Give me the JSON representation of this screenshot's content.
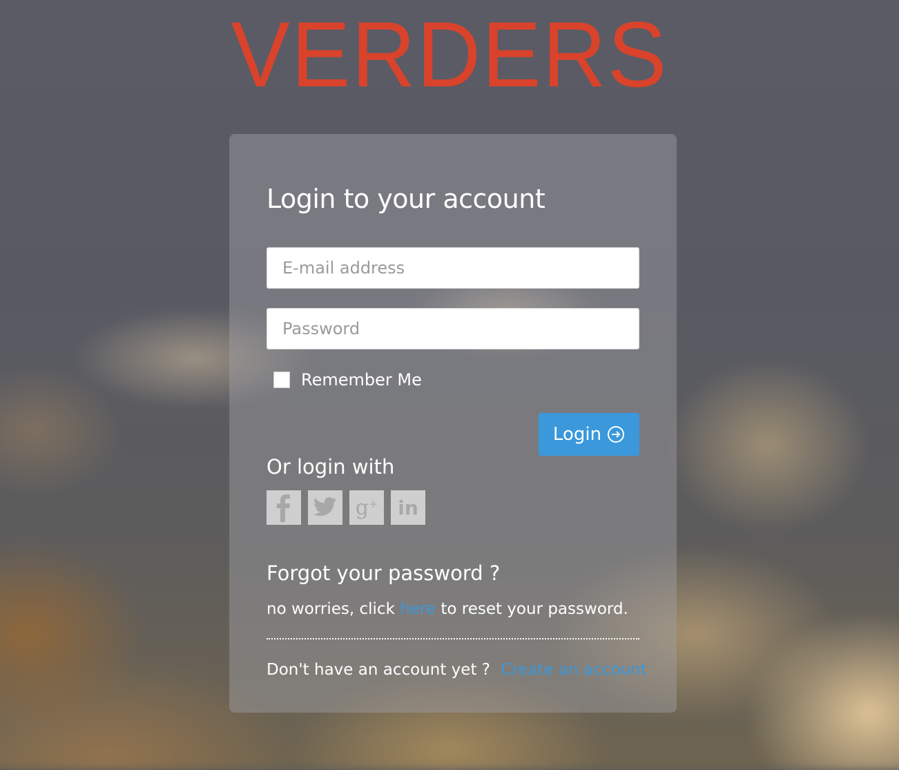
{
  "brand": {
    "logo_text": "VERDERS",
    "logo_color": "#d9432b"
  },
  "login_form": {
    "title": "Login to your account",
    "email_placeholder": "E-mail address",
    "password_placeholder": "Password",
    "remember_label": "Remember Me",
    "remember_checked": false,
    "login_button_label": "Login",
    "login_button_icon": "arrow-circle-right-icon",
    "accent_color": "#3a98db"
  },
  "social_login": {
    "heading": "Or login with",
    "providers": [
      {
        "name": "facebook",
        "glyph": "f"
      },
      {
        "name": "twitter",
        "glyph": "twitter-bird"
      },
      {
        "name": "google-plus",
        "glyph": "g+"
      },
      {
        "name": "linkedin",
        "glyph": "in"
      }
    ]
  },
  "forgot_password": {
    "heading": "Forgot your password ?",
    "text_before": "no worries, click",
    "link_text": "here",
    "text_after": "to reset your password."
  },
  "signup": {
    "text": "Don't have an account yet ?",
    "link_text": "Create an account"
  }
}
